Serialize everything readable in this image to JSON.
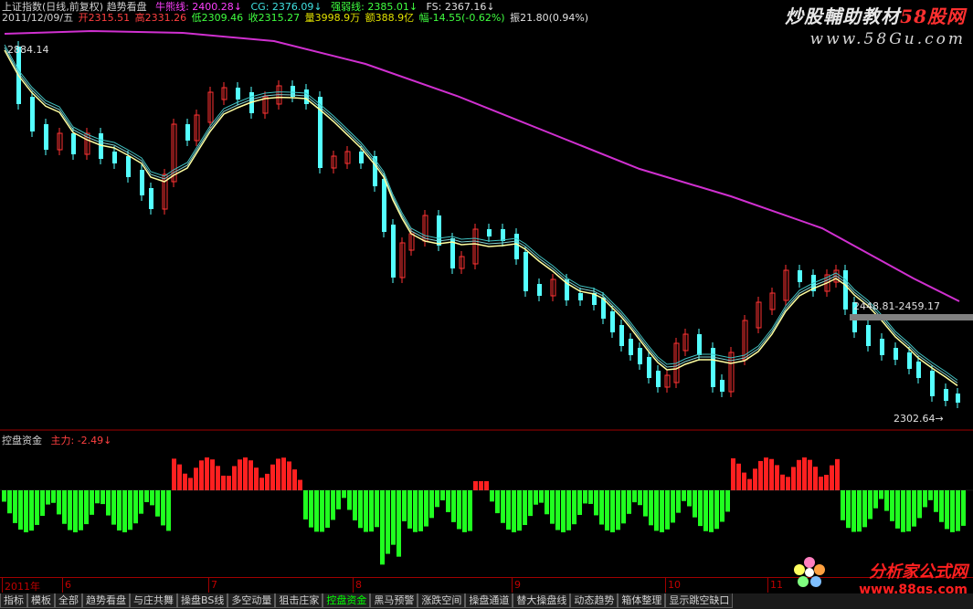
{
  "header": {
    "line1": {
      "title": "上证指数(日线,前复权) 趋势看盘",
      "niuxiong": "牛熊线: 2400.28↓",
      "cg": "CG: 2376.09↓",
      "qiangruo": "强弱线: 2385.01↓",
      "fs": "FS: 2367.16↓"
    },
    "line2": {
      "date": "2011/12/09/五",
      "open": "开2315.51",
      "high": "高2331.26",
      "low": "低2309.46",
      "close": "收2315.27",
      "volume": "量3998.9万",
      "amount": "额388.9亿",
      "change": "幅-14.55(-0.62%)",
      "amplitude": "振21.80(0.94%)"
    }
  },
  "watermark": {
    "line1_main": "炒股輔助教材",
    "line1_red": "58股网",
    "line2": "www.58Gu.com"
  },
  "annotations": {
    "high_label": "2884.14",
    "range_label": "2448.81-2459.17",
    "low_label": "2302.64→"
  },
  "indicator": {
    "name": "控盘资金",
    "main_label": "主力: -2.49↓"
  },
  "timeline": {
    "labels": [
      "2011年",
      "6",
      "7",
      "8",
      "9",
      "10",
      "11"
    ]
  },
  "tabs": [
    "指标",
    "模板",
    "全部",
    "趋势看盘",
    "与庄共舞",
    "操盘BS线",
    "多空动量",
    "狙击庄家",
    "控盘资金",
    "黑马预警",
    "涨跌空间",
    "操盘通道",
    "替大操盘线",
    "动态趋势",
    "箱体整理",
    "显示跳空缺口"
  ],
  "active_tab": "控盘资金",
  "logo": {
    "line1": "分析家公式网",
    "line2": "www.88gs.com"
  },
  "colors": {
    "background": "#000000",
    "up_candle": "#ff3232",
    "down_candle": "#54ffff",
    "ma_yellow": "#ffffa0",
    "ma_teal": "#40c0c0",
    "ma_magenta": "#d030d0",
    "bar_positive": "#ff2020",
    "bar_negative": "#20ff20",
    "header_red": "#ff4040",
    "header_green": "#40ff40"
  }
}
